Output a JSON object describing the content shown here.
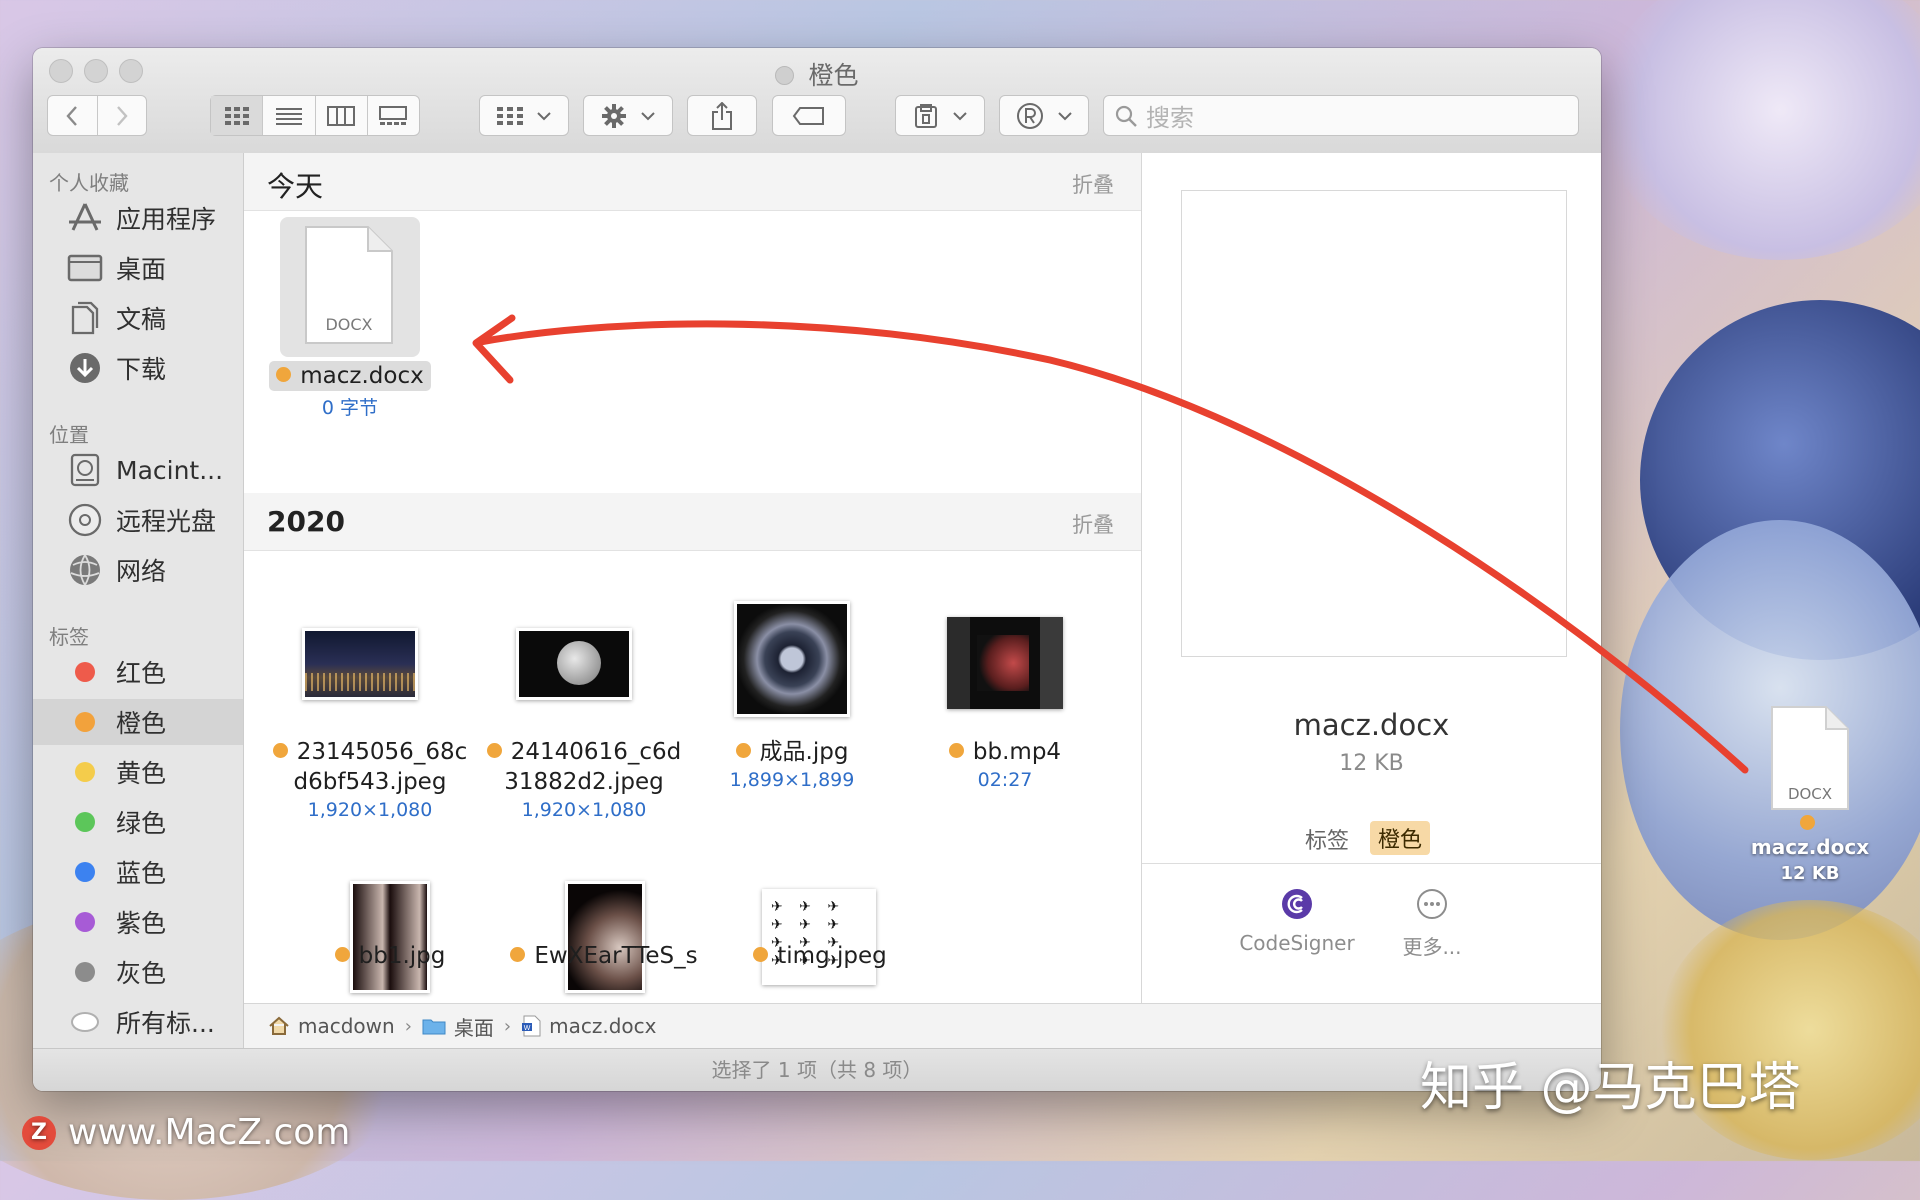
{
  "window": {
    "title": "橙色",
    "search_placeholder": "搜索"
  },
  "sidebar": {
    "favorites_header": "个人收藏",
    "favorites": [
      {
        "label": "应用程序",
        "icon": "applications-icon"
      },
      {
        "label": "桌面",
        "icon": "desktop-icon"
      },
      {
        "label": "文稿",
        "icon": "documents-icon"
      },
      {
        "label": "下载",
        "icon": "downloads-icon"
      }
    ],
    "locations_header": "位置",
    "locations": [
      {
        "label": "Macint...",
        "icon": "hard-drive-icon"
      },
      {
        "label": "远程光盘",
        "icon": "optical-disc-icon"
      },
      {
        "label": "网络",
        "icon": "network-icon"
      }
    ],
    "tags_header": "标签",
    "tags": [
      {
        "label": "红色",
        "color": "#ee5b4b"
      },
      {
        "label": "橙色",
        "color": "#f2a23c",
        "selected": true
      },
      {
        "label": "黄色",
        "color": "#f4cc4b"
      },
      {
        "label": "绿色",
        "color": "#5cc65a"
      },
      {
        "label": "蓝色",
        "color": "#3c82f0"
      },
      {
        "label": "紫色",
        "color": "#a75bd6"
      },
      {
        "label": "灰色",
        "color": "#8c8c8c"
      },
      {
        "label": "所有标...",
        "color": "#ffffff"
      }
    ]
  },
  "groups": {
    "today": {
      "title": "今天",
      "fold": "折叠"
    },
    "year": {
      "title": "2020",
      "fold": "折叠"
    }
  },
  "files_today": [
    {
      "name": "macz.docx",
      "meta": "0 字节",
      "type_label": "DOCX",
      "tag_color": "#f2a23c"
    }
  ],
  "files_2020": [
    {
      "name_line1": "23145056_68c",
      "name_line2": "d6bf543.jpeg",
      "meta": "1,920×1,080"
    },
    {
      "name_line1": "24140616_c6d",
      "name_line2": "31882d2.jpeg",
      "meta": "1,920×1,080"
    },
    {
      "name_line1": "成品.jpg",
      "name_line2": "",
      "meta": "1,899×1,899"
    },
    {
      "name_line1": "bb.mp4",
      "name_line2": "",
      "meta": "02:27"
    },
    {
      "name_line1": "bb1.jpg",
      "name_line2": "",
      "meta": ""
    },
    {
      "name_line1": "EwXEarTTeS_s",
      "name_line2": "",
      "meta": ""
    },
    {
      "name_line1": "timg.jpeg",
      "name_line2": "",
      "meta": ""
    }
  ],
  "preview": {
    "name": "macz.docx",
    "size": "12 KB",
    "tag_label": "标签",
    "tag_value": "橙色",
    "actions": [
      {
        "label": "CodeSigner",
        "icon": "codesigner-icon"
      },
      {
        "label": "更多...",
        "icon": "more-icon"
      }
    ]
  },
  "pathbar": {
    "crumbs": [
      "macdown",
      "桌面",
      "macz.docx"
    ]
  },
  "status": "选择了 1 项（共 8 项）",
  "desktop_file": {
    "name": "macz.docx",
    "size": "12 KB",
    "type_label": "DOCX"
  },
  "watermarks": {
    "left": "www.MacZ.com",
    "left_logo": "Z",
    "right": "知乎 @马克巴塔"
  },
  "colors": {
    "accent_arrow": "#e8412f",
    "tag_orange": "#f2a23c",
    "meta_blue": "#2f6ec8"
  }
}
